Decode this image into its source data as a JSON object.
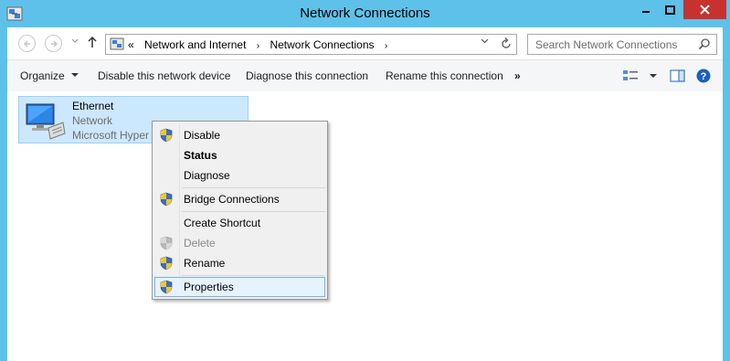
{
  "window": {
    "title": "Network Connections"
  },
  "address_bar": {
    "prefix": "«",
    "crumbs": [
      "Network and Internet",
      "Network Connections"
    ],
    "separator": "›"
  },
  "search": {
    "placeholder": "Search Network Connections"
  },
  "toolbar": {
    "organize": "Organize",
    "disable": "Disable this network device",
    "diagnose": "Diagnose this connection",
    "rename": "Rename this connection",
    "more": "»"
  },
  "adapter": {
    "name": "Ethernet",
    "status": "Network",
    "device": "Microsoft Hyper"
  },
  "context_menu": {
    "items": [
      {
        "label": "Disable",
        "icon": "uac-shield-icon",
        "enabled": true,
        "bold": false
      },
      {
        "label": "Status",
        "icon": "",
        "enabled": true,
        "bold": true
      },
      {
        "label": "Diagnose",
        "icon": "",
        "enabled": true,
        "bold": false
      },
      {
        "label": "Bridge Connections",
        "icon": "uac-shield-icon",
        "enabled": true,
        "bold": false
      },
      {
        "label": "Create Shortcut",
        "icon": "",
        "enabled": true,
        "bold": false
      },
      {
        "label": "Delete",
        "icon": "uac-shield-icon",
        "enabled": false,
        "bold": false
      },
      {
        "label": "Rename",
        "icon": "uac-shield-icon",
        "enabled": true,
        "bold": false
      },
      {
        "label": "Properties",
        "icon": "uac-shield-icon",
        "enabled": true,
        "bold": false,
        "highlighted": true
      }
    ]
  },
  "colors": {
    "frame": "#5ec1ea",
    "close_button": "#c7312e",
    "selection": "#cce8ff",
    "menu_highlight": "#e5f3ff"
  }
}
